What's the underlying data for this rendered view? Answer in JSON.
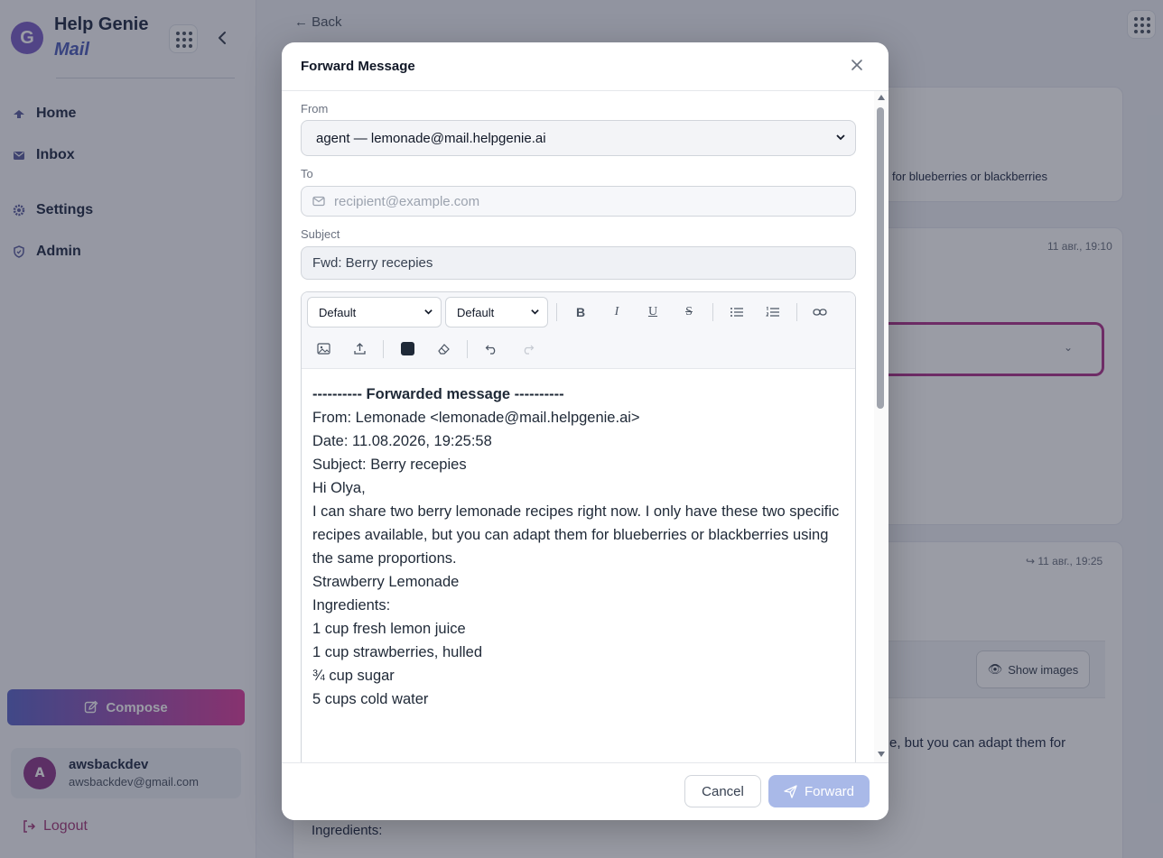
{
  "sidebar": {
    "brand_line1": "Help Genie",
    "brand_line2": "Mail",
    "nav": {
      "home": "Home",
      "inbox": "Inbox",
      "settings": "Settings",
      "admin": "Admin"
    },
    "compose_label": "Compose",
    "user": {
      "initial": "A",
      "name": "awsbackdev",
      "email": "awsbackdev@gmail.com"
    },
    "logout_label": "Logout"
  },
  "main": {
    "back_label": "Back",
    "snippet_1": "for blueberries or blackberries",
    "timestamp_1": "11 авг., 19:10",
    "timestamp_2": "11 авг., 19:25",
    "show_images_label": "Show images",
    "snippet_2": "e, but you can adapt them for",
    "ingredients_label": "Ingredients:"
  },
  "modal": {
    "title": "Forward Message",
    "from_label": "From",
    "from_value": "agent — lemonade@mail.helpgenie.ai",
    "to_label": "To",
    "to_placeholder": "recipient@example.com",
    "subject_label": "Subject",
    "subject_value": "Fwd: Berry recepies",
    "toolbar": {
      "font_select": "Default",
      "size_select": "Default",
      "bold": "B",
      "italic": "I",
      "underline": "U",
      "strike": "S"
    },
    "body_lines": [
      "---------- Forwarded message ----------",
      "From: Lemonade <lemonade@mail.helpgenie.ai>",
      "Date: 11.08.2026, 19:25:58",
      "Subject: Berry recepies",
      "Hi Olya,",
      "I can share two berry lemonade recipes right now. I only have these two specific recipes available, but you can adapt them for blueberries or blackberries using the same proportions.",
      "Strawberry Lemonade",
      "Ingredients:",
      "1 cup fresh lemon juice",
      "1 cup strawberries, hulled",
      "¾ cup sugar",
      "5 cups cold water"
    ],
    "cancel_label": "Cancel",
    "forward_label": "Forward"
  },
  "icons": {
    "logo": "helpgenie-logo-icon",
    "apps": "apps-grid-icon",
    "back": "arrow-left-icon",
    "close": "close-icon",
    "mail": "mail-icon",
    "send": "send-icon"
  },
  "colors": {
    "accent": "#4e5dbb",
    "compose_gradient_start": "#5c66c9",
    "compose_gradient_end": "#dd3f9d",
    "forward_disabled": "#a9b9e8",
    "highlight_border": "#b0338d"
  }
}
